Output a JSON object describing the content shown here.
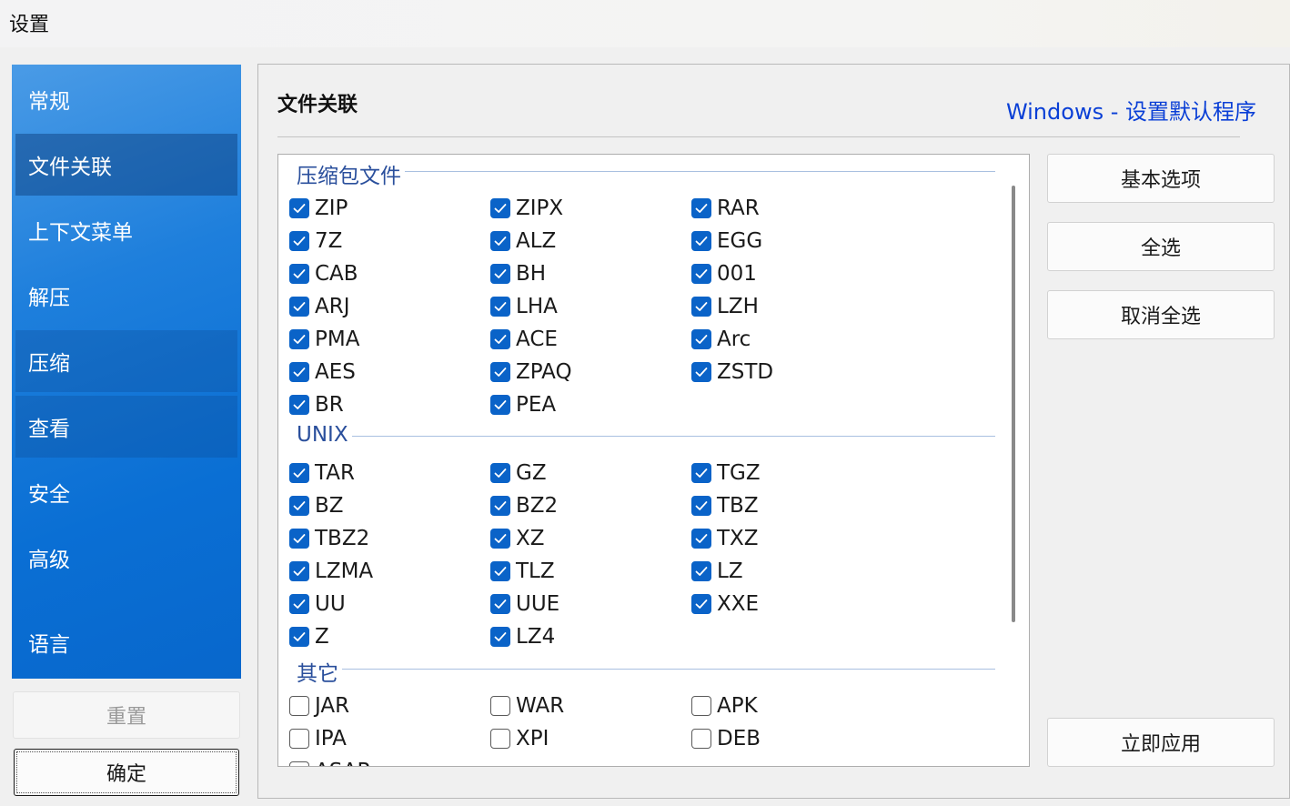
{
  "window": {
    "title": "设置"
  },
  "sidebar": {
    "items": [
      {
        "label": "常规"
      },
      {
        "label": "文件关联"
      },
      {
        "label": "上下文菜单"
      },
      {
        "label": "解压"
      },
      {
        "label": "压缩"
      },
      {
        "label": "查看"
      },
      {
        "label": "安全"
      },
      {
        "label": "高级"
      },
      {
        "label": "语言"
      }
    ],
    "active_index": 1,
    "reset_label": "重置",
    "ok_label": "确定"
  },
  "main": {
    "title": "文件关联",
    "windows_link": "Windows - 设置默认程序",
    "buttons": {
      "basic": "基本选项",
      "select_all": "全选",
      "deselect_all": "取消全选",
      "apply": "立即应用"
    },
    "groups": [
      {
        "name": "压缩包文件",
        "items": [
          {
            "label": "ZIP",
            "checked": true
          },
          {
            "label": "ZIPX",
            "checked": true
          },
          {
            "label": "RAR",
            "checked": true
          },
          {
            "label": "7Z",
            "checked": true
          },
          {
            "label": "ALZ",
            "checked": true
          },
          {
            "label": "EGG",
            "checked": true
          },
          {
            "label": "CAB",
            "checked": true
          },
          {
            "label": "BH",
            "checked": true
          },
          {
            "label": "001",
            "checked": true
          },
          {
            "label": "ARJ",
            "checked": true
          },
          {
            "label": "LHA",
            "checked": true
          },
          {
            "label": "LZH",
            "checked": true
          },
          {
            "label": "PMA",
            "checked": true
          },
          {
            "label": "ACE",
            "checked": true
          },
          {
            "label": "Arc",
            "checked": true
          },
          {
            "label": "AES",
            "checked": true
          },
          {
            "label": "ZPAQ",
            "checked": true
          },
          {
            "label": "ZSTD",
            "checked": true
          },
          {
            "label": "BR",
            "checked": true
          },
          {
            "label": "PEA",
            "checked": true
          }
        ]
      },
      {
        "name": "UNIX",
        "items": [
          {
            "label": "TAR",
            "checked": true
          },
          {
            "label": "GZ",
            "checked": true
          },
          {
            "label": "TGZ",
            "checked": true
          },
          {
            "label": "BZ",
            "checked": true
          },
          {
            "label": "BZ2",
            "checked": true
          },
          {
            "label": "TBZ",
            "checked": true
          },
          {
            "label": "TBZ2",
            "checked": true
          },
          {
            "label": "XZ",
            "checked": true
          },
          {
            "label": "TXZ",
            "checked": true
          },
          {
            "label": "LZMA",
            "checked": true
          },
          {
            "label": "TLZ",
            "checked": true
          },
          {
            "label": "LZ",
            "checked": true
          },
          {
            "label": "UU",
            "checked": true
          },
          {
            "label": "UUE",
            "checked": true
          },
          {
            "label": "XXE",
            "checked": true
          },
          {
            "label": "Z",
            "checked": true
          },
          {
            "label": "LZ4",
            "checked": true
          }
        ]
      },
      {
        "name": "其它",
        "items": [
          {
            "label": "JAR",
            "checked": false
          },
          {
            "label": "WAR",
            "checked": false
          },
          {
            "label": "APK",
            "checked": false
          },
          {
            "label": "IPA",
            "checked": false
          },
          {
            "label": "XPI",
            "checked": false
          },
          {
            "label": "DEB",
            "checked": false
          },
          {
            "label": "ASAR",
            "checked": false
          }
        ]
      }
    ]
  },
  "colors": {
    "accent": "#0a63c8",
    "link": "#0a3fd6",
    "sidebar_top": "#4a9be6",
    "sidebar_bottom": "#0867cc",
    "group_header": "#2a4f9c"
  }
}
